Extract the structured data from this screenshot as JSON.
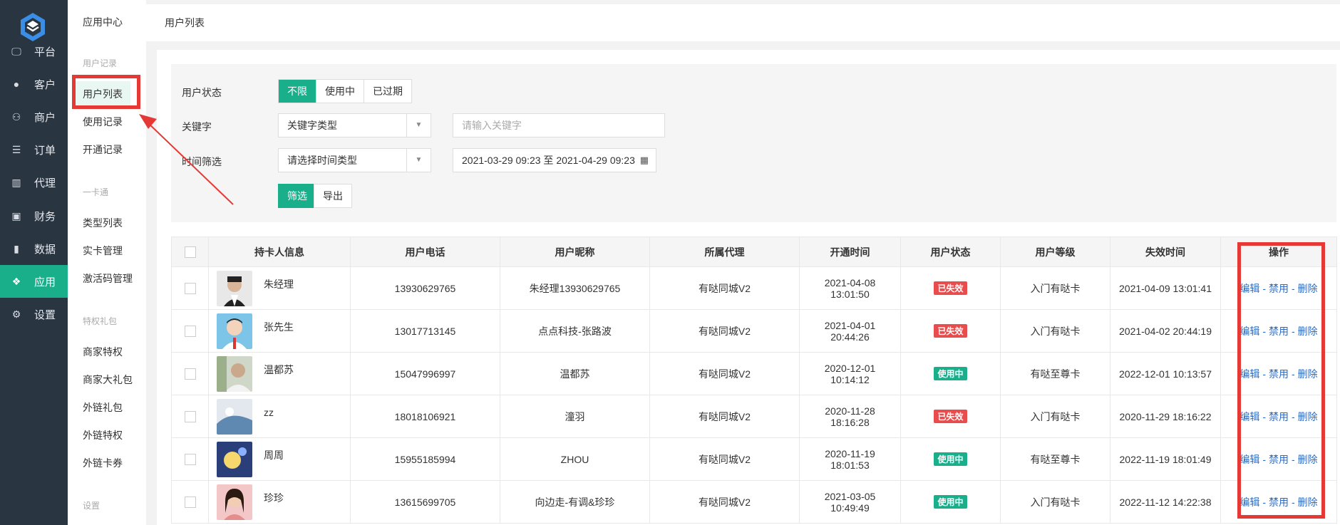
{
  "nav": {
    "items": [
      {
        "label": "平台",
        "icon": "monitor-icon"
      },
      {
        "label": "客户",
        "icon": "user-icon"
      },
      {
        "label": "商户",
        "icon": "users-icon"
      },
      {
        "label": "订单",
        "icon": "list-icon"
      },
      {
        "label": "代理",
        "icon": "map-icon"
      },
      {
        "label": "财务",
        "icon": "money-icon"
      },
      {
        "label": "数据",
        "icon": "bar-chart-icon"
      },
      {
        "label": "应用",
        "icon": "cubes-icon"
      },
      {
        "label": "设置",
        "icon": "gear-icon"
      }
    ],
    "active": "应用"
  },
  "subnav": {
    "title": "应用中心",
    "groups": [
      {
        "title": "用户记录",
        "items": [
          "用户列表",
          "使用记录",
          "开通记录"
        ]
      },
      {
        "title": "一卡通",
        "items": [
          "类型列表",
          "实卡管理",
          "激活码管理"
        ]
      },
      {
        "title": "特权礼包",
        "items": [
          "商家特权",
          "商家大礼包",
          "外链礼包",
          "外链特权",
          "外链卡券"
        ]
      },
      {
        "title": "设置",
        "items": []
      }
    ],
    "active": "用户列表"
  },
  "breadcrumb": {
    "current": "用户列表"
  },
  "filter": {
    "status_label": "用户状态",
    "status_options": [
      "不限",
      "使用中",
      "已过期"
    ],
    "status_selected": "不限",
    "keyword_label": "关键字",
    "keyword_type": "关键字类型",
    "keyword_placeholder": "请输入关键字",
    "time_label": "时间筛选",
    "time_type": "请选择时间类型",
    "date_range": "2021-03-29 09:23 至 2021-04-29 09:23",
    "filter_button": "筛选",
    "export_button": "导出"
  },
  "table": {
    "headers": [
      "持卡人信息",
      "用户电话",
      "用户昵称",
      "所属代理",
      "开通时间",
      "用户状态",
      "用户等级",
      "失效时间",
      "操作"
    ],
    "rows": [
      {
        "name": "朱经理",
        "phone": "13930629765",
        "nickname": "朱经理13930629765",
        "agent": "有哒同城V2",
        "open_date": "2021-04-08",
        "open_time": "13:01:50",
        "status": "已失效",
        "status_color": "#e84c4c",
        "level": "入门有哒卡",
        "expire": "2021-04-09 13:01:41"
      },
      {
        "name": "张先生",
        "phone": "13017713145",
        "nickname": "点点科技-张路波",
        "agent": "有哒同城V2",
        "open_date": "2021-04-01",
        "open_time": "20:44:26",
        "status": "已失效",
        "status_color": "#e84c4c",
        "level": "入门有哒卡",
        "expire": "2021-04-02 20:44:19"
      },
      {
        "name": "温都苏",
        "phone": "15047996997",
        "nickname": "温都苏",
        "agent": "有哒同城V2",
        "open_date": "2020-12-01",
        "open_time": "10:14:12",
        "status": "使用中",
        "status_color": "#1aaf8b",
        "level": "有哒至尊卡",
        "expire": "2022-12-01 10:13:57"
      },
      {
        "name": "zz",
        "phone": "18018106921",
        "nickname": "潼羽",
        "agent": "有哒同城V2",
        "open_date": "2020-11-28",
        "open_time": "18:16:28",
        "status": "已失效",
        "status_color": "#e84c4c",
        "level": "入门有哒卡",
        "expire": "2020-11-29 18:16:22"
      },
      {
        "name": "周周",
        "phone": "15955185994",
        "nickname": "ZHOU",
        "agent": "有哒同城V2",
        "open_date": "2020-11-19",
        "open_time": "18:01:53",
        "status": "使用中",
        "status_color": "#1aaf8b",
        "level": "有哒至尊卡",
        "expire": "2022-11-19 18:01:49"
      },
      {
        "name": "珍珍",
        "phone": "13615699705",
        "nickname": "向边走-有调&珍珍",
        "agent": "有哒同城V2",
        "open_date": "2021-03-05",
        "open_time": "10:49:49",
        "status": "使用中",
        "status_color": "#1aaf8b",
        "level": "入门有哒卡",
        "expire": "2022-11-12 14:22:38"
      }
    ],
    "actions": [
      "编辑",
      "禁用",
      "删除"
    ],
    "action_separator": "-"
  },
  "colors": {
    "accent": "#1aaf8b",
    "nav_bg": "#2a3542",
    "danger": "#e84c4c",
    "link": "#2d6bbf",
    "annotation": "#e53935"
  }
}
